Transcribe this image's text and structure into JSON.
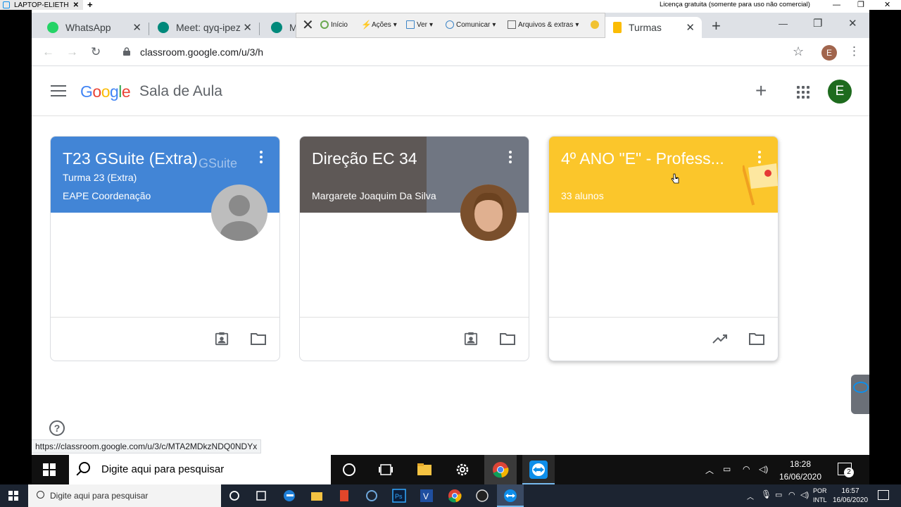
{
  "teamviewer": {
    "tab_label": "LAPTOP-ELIETH",
    "tab_close": "✕",
    "new_tab": "+",
    "license": "Licença gratuita (somente para uso não comercial)",
    "window_controls": {
      "minimize": "—",
      "restore": "❐",
      "close": "✕"
    },
    "toolbar": {
      "close": "✕",
      "items": [
        "Início",
        "Ações",
        "Ver",
        "Comunicar",
        "Arquivos & extras"
      ]
    }
  },
  "browser": {
    "tabs": [
      {
        "label": "WhatsApp",
        "icon": "whatsapp-icon",
        "color": "#25d366"
      },
      {
        "label": "Meet: qyq-ipez",
        "icon": "meet-icon",
        "color": "#00897b"
      },
      {
        "label": "M",
        "icon": "meet-icon",
        "color": "#00897b"
      },
      {
        "label": "Turmas",
        "icon": "classroom-icon",
        "color": "#fbbc04"
      }
    ],
    "tab_close": "✕",
    "new_tab": "+",
    "controls": {
      "minimize": "—",
      "restore": "❐",
      "close": "✕"
    },
    "url": "classroom.google.com/u/3/h",
    "profile_initial": "E",
    "back": "←",
    "forward": "→",
    "reload": "↻",
    "star": "☆",
    "menu": "⋮"
  },
  "classroom": {
    "logo": {
      "g": "G",
      "o1": "o",
      "o2": "o",
      "g2": "g",
      "l": "l",
      "e": "e"
    },
    "app_name": "Sala de Aula",
    "add_icon": "+",
    "avatar_initial": "E",
    "cards": [
      {
        "title": "T23 GSuite (Extra)",
        "section": "Turma 23 (Extra)",
        "teacher": "EAPE Coordenação",
        "color": "#4285d6"
      },
      {
        "title": "Direção EC 34",
        "teacher": "Margarete Joaquim Da Silva",
        "color": "#5e5856"
      },
      {
        "title": "4º ANO \"E\" - Profess...",
        "students": "33 alunos",
        "color": "#fbc62b"
      }
    ],
    "help": "?",
    "status_url": "https://classroom.google.com/u/3/c/MTA2MDkzNDQ0NDYx"
  },
  "remote_taskbar": {
    "search_placeholder": "Digite aqui para pesquisar",
    "time": "18:28",
    "date": "16/06/2020",
    "notifications": "2"
  },
  "local_taskbar": {
    "search_placeholder": "Digite aqui para pesquisar",
    "lang_1": "POR",
    "lang_2": "INTL",
    "time": "16:57",
    "date": "16/06/2020"
  }
}
